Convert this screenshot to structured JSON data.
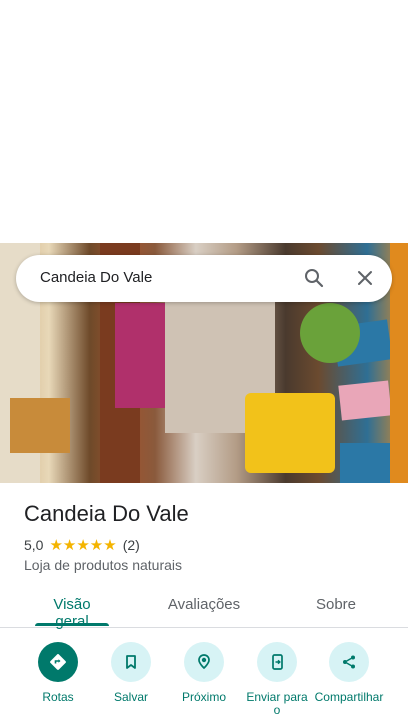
{
  "search": {
    "query": "Candeia Do Vale"
  },
  "place": {
    "name": "Candeia Do Vale",
    "rating": "5,0",
    "stars": "★★★★★",
    "review_count": "(2)",
    "category": "Loja de produtos naturais"
  },
  "tabs": [
    {
      "label": "Visão geral",
      "active": true
    },
    {
      "label": "Avaliações",
      "active": false
    },
    {
      "label": "Sobre",
      "active": false
    }
  ],
  "actions": [
    {
      "label": "Rotas",
      "icon": "directions-icon"
    },
    {
      "label": "Salvar",
      "icon": "bookmark-icon"
    },
    {
      "label": "Próximo",
      "icon": "nearby-icon"
    },
    {
      "label": "Enviar para o",
      "icon": "send-to-phone-icon"
    },
    {
      "label": "Compartilhar",
      "icon": "share-icon"
    }
  ],
  "colors": {
    "accent": "#00796b",
    "chip_bg": "#d7f3f5",
    "star": "#f4b400"
  }
}
